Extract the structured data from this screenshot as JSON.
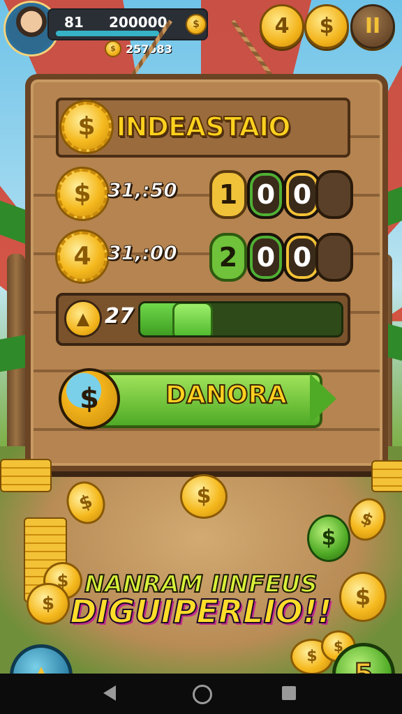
{
  "hud": {
    "level": "81",
    "score": "200000",
    "sub_coins": "257583",
    "buttons": {
      "coin_a": "4",
      "coin_b": "$",
      "pause": "II"
    }
  },
  "board": {
    "title": "INDEASTAIO",
    "rows": [
      {
        "value": "31,:50",
        "digits": [
          "1",
          "0",
          "0",
          ""
        ]
      },
      {
        "value": "31,:00",
        "digits": [
          "2",
          "0",
          "0",
          ""
        ]
      }
    ],
    "progress": {
      "value_label": "27",
      "fill_fraction": 0.16
    },
    "cta_label": "DANORA"
  },
  "promo": {
    "line1": "NANRAM IINFEUS",
    "line2": "DIGUIPERLIO!!"
  },
  "corner": {
    "left_icon": "arrow-icon",
    "right_label": "5"
  },
  "colors": {
    "gold": "#f3b41c",
    "green": "#4faa25",
    "wood": "#8a6037"
  }
}
